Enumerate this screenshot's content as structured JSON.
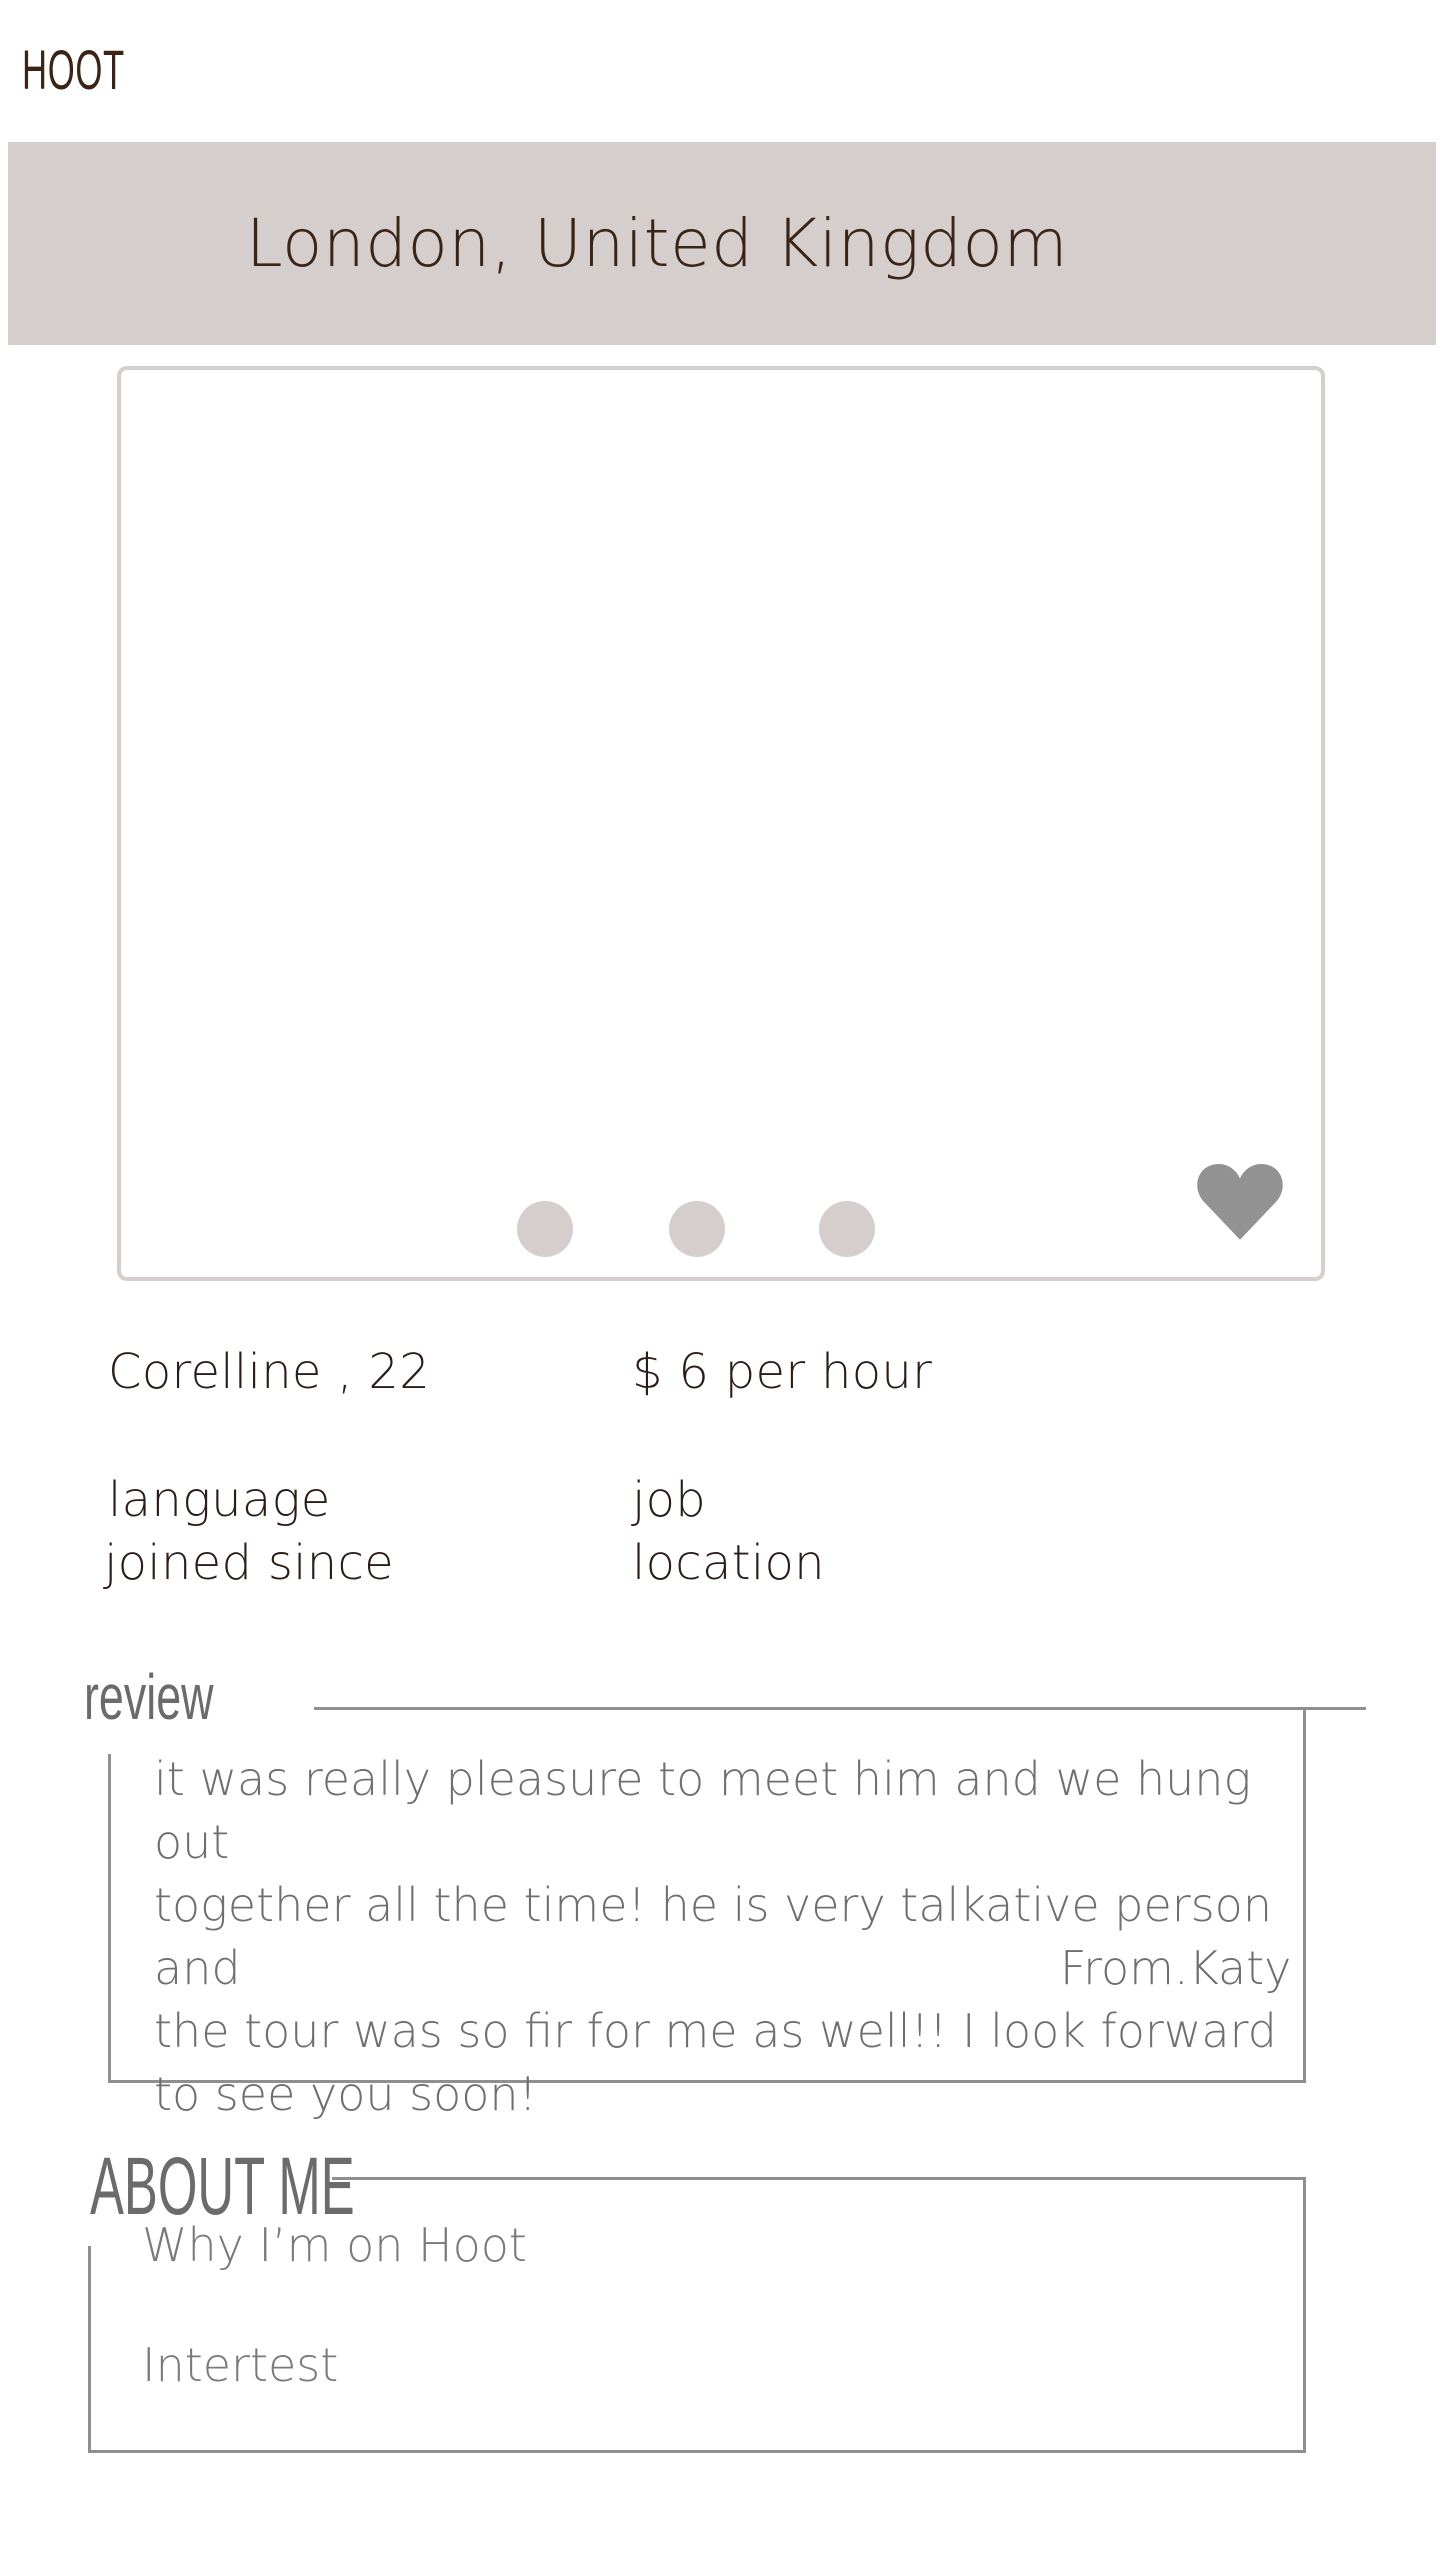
{
  "app": {
    "logo": "HOOT"
  },
  "header": {
    "city": "London, United Kingdom"
  },
  "gallery": {
    "dots": [
      "photo-1",
      "photo-2",
      "photo-3"
    ],
    "favorite_icon": "heart-icon",
    "colors": {
      "dot": "#d6cdcd",
      "heart": "#929292",
      "border": "#d6cdcd"
    }
  },
  "profile": {
    "name_age": "Corelline , 22",
    "rate": "$ 6 per hour",
    "language": "language",
    "job": "job",
    "joined": "joined since",
    "location": "location"
  },
  "review": {
    "title": "review",
    "lines": [
      "it was really pleasure to meet him and we hung out",
      "together all the time! he is very talkative person and",
      "the tour was so fir for me as well!! I look forward",
      "to see you soon!"
    ],
    "author": "From.Katy"
  },
  "about": {
    "title": "ABOUT ME",
    "why": "Why I’m on Hoot",
    "interest": "Intertest"
  },
  "colors": {
    "header_bg": "#d6cdcd",
    "text_dark": "#2b1d18",
    "text_muted": "#6f6f6f"
  }
}
